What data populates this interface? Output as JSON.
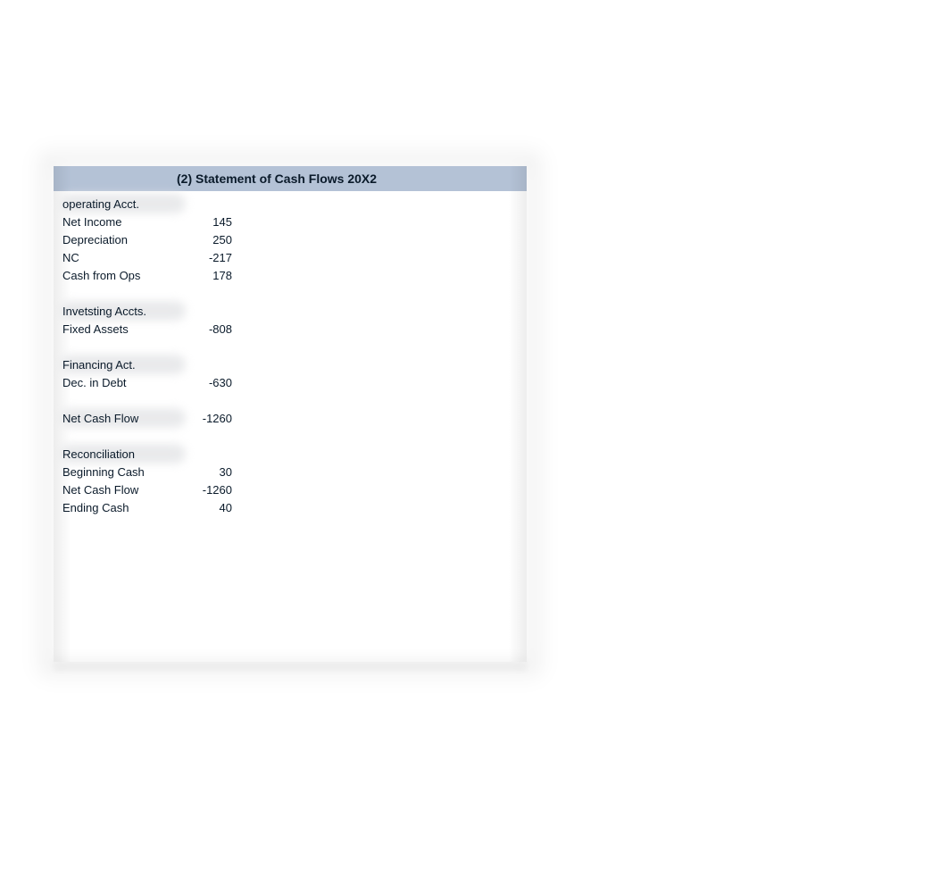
{
  "header": {
    "title": "(2) Statement of Cash Flows 20X2"
  },
  "sections": {
    "operating": {
      "heading": "operating Acct.",
      "items": [
        {
          "label": "Net Income",
          "value": "145"
        },
        {
          "label": "Depreciation",
          "value": "250"
        },
        {
          "label": "NC",
          "value": "-217"
        },
        {
          "label": "Cash from Ops",
          "value": "178"
        }
      ]
    },
    "investing": {
      "heading": "Invetsting Accts.",
      "items": [
        {
          "label": "Fixed Assets",
          "value": "-808"
        }
      ]
    },
    "financing": {
      "heading": "Financing Act.",
      "items": [
        {
          "label": "Dec. in Debt",
          "value": "-630"
        }
      ]
    },
    "netcash": {
      "items": [
        {
          "label": "Net Cash Flow",
          "value": "-1260"
        }
      ]
    },
    "reconciliation": {
      "heading": "Reconciliation",
      "items": [
        {
          "label": "Beginning Cash",
          "value": "30"
        },
        {
          "label": "Net Cash Flow",
          "value": "-1260"
        },
        {
          "label": "Ending Cash",
          "value": "40"
        }
      ]
    }
  }
}
